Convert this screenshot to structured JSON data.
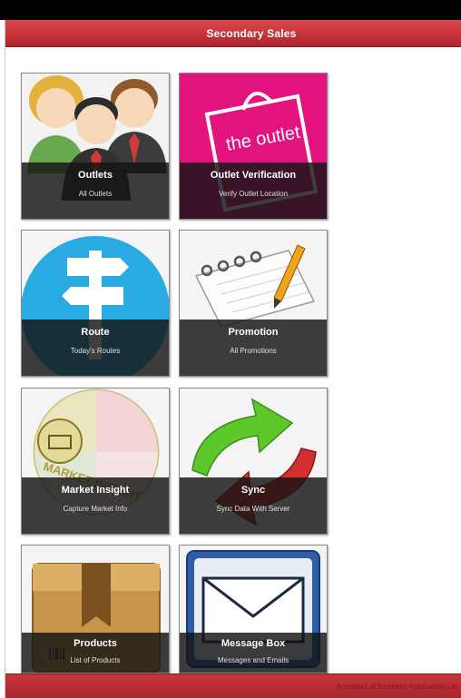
{
  "header": {
    "title": "Secondary Sales"
  },
  "tiles": [
    {
      "title": "Outlets",
      "subtitle": "All Outlets",
      "icon": "people-icon"
    },
    {
      "title": "Outlet Verification",
      "subtitle": "Verify Outlet Location",
      "icon": "outlet-bag-icon",
      "art_text": "the outlet"
    },
    {
      "title": "Route",
      "subtitle": "Today's Routes",
      "icon": "signpost-icon"
    },
    {
      "title": "Promotion",
      "subtitle": "All Promotions",
      "icon": "notepad-pencil-icon"
    },
    {
      "title": "Market Insight",
      "subtitle": "Capture Market Info",
      "icon": "market-insight-icon",
      "art_text": "MARKET INSIGHT"
    },
    {
      "title": "Sync",
      "subtitle": "Sync Data With Server",
      "icon": "sync-arrows-icon"
    },
    {
      "title": "Products",
      "subtitle": "List of Products",
      "icon": "product-box-icon"
    },
    {
      "title": "Message Box",
      "subtitle": "Messages and Emails",
      "icon": "envelope-icon"
    }
  ],
  "footer": {
    "text": "A product of Business Automation Ltd"
  },
  "colors": {
    "header_red": "#c8343b",
    "caption_bg": "#141414",
    "pink": "#e2137f",
    "sky_blue": "#29abe2"
  }
}
